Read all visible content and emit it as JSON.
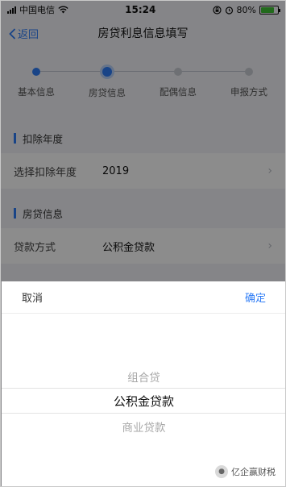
{
  "status_bar": {
    "carrier": "中国电信",
    "time": "15:24",
    "battery": "80%",
    "battery_level": 0.8
  },
  "nav": {
    "back_label": "返回",
    "title": "房贷利息信息填写"
  },
  "steps": [
    {
      "label": "基本信息",
      "state": "done"
    },
    {
      "label": "房贷信息",
      "state": "current"
    },
    {
      "label": "配偶信息",
      "state": "todo"
    },
    {
      "label": "申报方式",
      "state": "todo"
    }
  ],
  "deduction_section": {
    "title": "扣除年度",
    "row_label": "选择扣除年度",
    "row_value": "2019"
  },
  "loan_section": {
    "title": "房贷信息",
    "row_label": "贷款方式",
    "row_value": "公积金贷款"
  },
  "picker": {
    "cancel_label": "取消",
    "confirm_label": "确定",
    "options": [
      "组合贷",
      "公积金贷款",
      "商业贷款"
    ],
    "selected": "公积金贷款"
  },
  "watermark": {
    "text": "亿企赢财税"
  },
  "colors": {
    "accent": "#2e7cf6",
    "battery_green": "#3fc234"
  }
}
